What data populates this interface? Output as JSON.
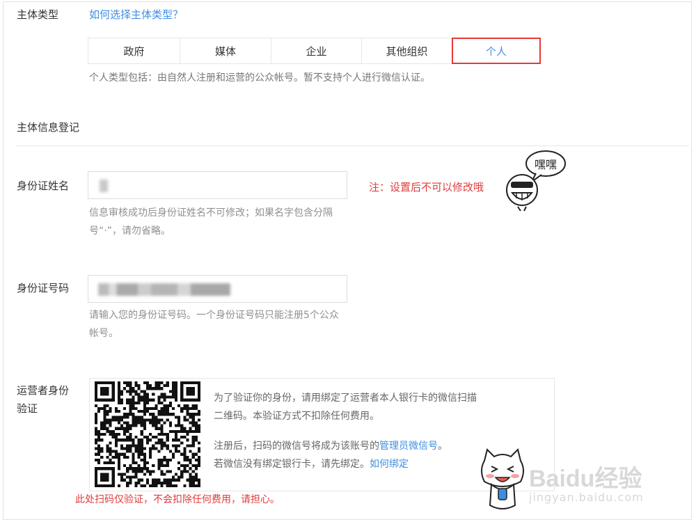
{
  "entity_type": {
    "label": "主体类型",
    "help_link": "如何选择主体类型？",
    "tabs": [
      "政府",
      "媒体",
      "企业",
      "其他组织",
      "个人"
    ],
    "active_tab": "个人",
    "description": "个人类型包括：由自然人注册和运营的公众帐号。暂不支持个人进行微信认证。"
  },
  "registration": {
    "section_title": "主体信息登记",
    "id_name": {
      "label": "身份证姓名",
      "note": "注：设置后不可以修改哦",
      "hint_line1": "信息审核成功后身份证姓名不可修改；如果名字包含分隔",
      "hint_line2": "号“·”，请勿省略。"
    },
    "id_number": {
      "label": "身份证号码",
      "hint_line1": "请输入您的身份证号码。一个身份证号码只能注册5个公众",
      "hint_line2": "帐号。"
    },
    "operator_verify": {
      "label_line1": "运营者身份",
      "label_line2": "验证",
      "text_line1": "为了验证你的身份，请用绑定了运营者本人银行卡的微信扫描",
      "text_line2": "二维码。本验证方式不扣除任何费用。",
      "text_line3_prefix": "注册后，扫码的微信号将成为该账号的",
      "text_line3_link": "管理员微信号",
      "text_line3_suffix": "。",
      "text_line4_prefix": "若微信没有绑定银行卡，请先绑定。",
      "text_line4_link": "如何绑定",
      "red_note": "此处扫码仅验证，不会扣除任何费用，请担心。"
    }
  },
  "stickers": {
    "bubble_text": "嘿嘿"
  },
  "watermark": {
    "main": "Baidu经验",
    "sub": "jingyan.baidu.com"
  },
  "colors": {
    "link": "#3e8ee3",
    "accent_red": "#e53935",
    "hint_gray": "#8f8f8f"
  }
}
